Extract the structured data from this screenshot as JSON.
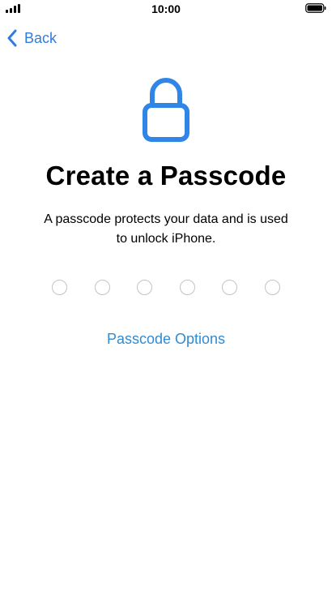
{
  "status_bar": {
    "time": "10:00",
    "signal_icon": "cellular-signal-icon",
    "battery_icon": "battery-full-icon"
  },
  "nav": {
    "back_label": "Back",
    "back_icon": "chevron-left-icon"
  },
  "header": {
    "icon": "lock-icon",
    "title": "Create a Passcode",
    "subtitle_line1": "A passcode protects your data and is used",
    "subtitle_line2": "to unlock iPhone."
  },
  "passcode": {
    "length": 6,
    "entered": 0
  },
  "options": {
    "label": "Passcode Options"
  },
  "colors": {
    "accent_blue": "#2f7de1",
    "link_blue": "#2f8bd2",
    "dot_border": "#c3c3c3",
    "lock_blue": "#2f86e6"
  }
}
